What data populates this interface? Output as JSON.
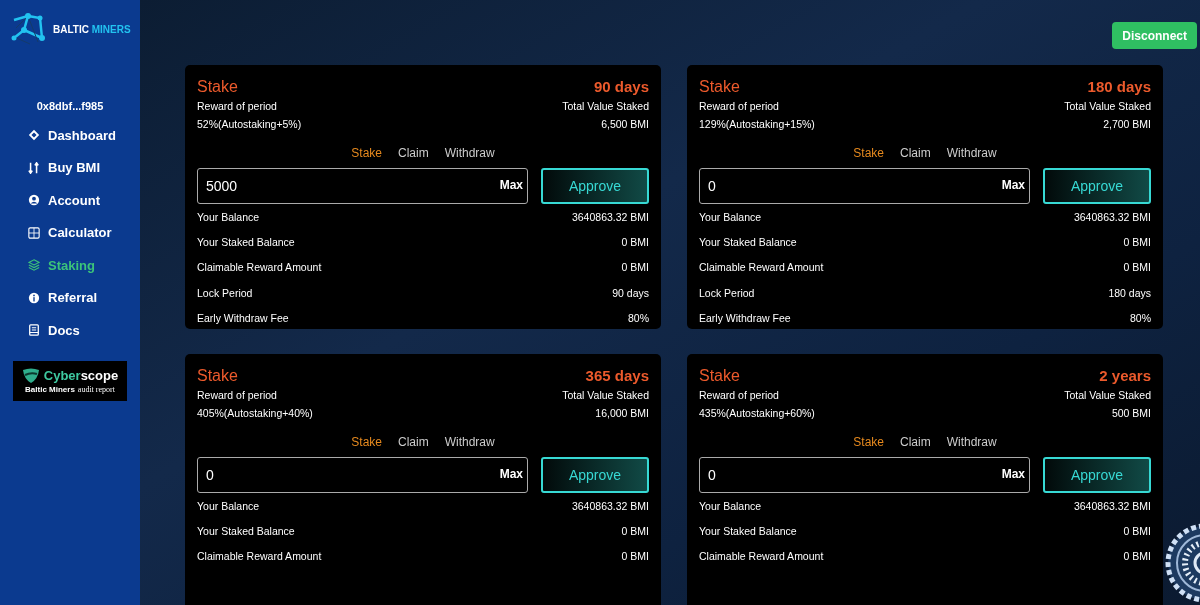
{
  "sidebar": {
    "logo": {
      "word_1": "BALTIC",
      "word_2": "MINERS"
    },
    "address": "0x8dbf...f985",
    "nav": [
      {
        "label": "Dashboard",
        "selected": false
      },
      {
        "label": "Buy BMI",
        "selected": false
      },
      {
        "label": "Account",
        "selected": false
      },
      {
        "label": "Calculator",
        "selected": false
      },
      {
        "label": "Staking",
        "selected": true
      },
      {
        "label": "Referral",
        "selected": false
      },
      {
        "label": "Docs",
        "selected": false
      }
    ],
    "audit_badge": {
      "brand_1": "Cyber",
      "brand_2": "scope",
      "project": "Baltic Miners",
      "caption": "audit report"
    }
  },
  "header": {
    "button": "Disconnect"
  },
  "pools": [
    {
      "title": "Stake",
      "period": "90 days",
      "reward_label": "Reward of period",
      "reward": "52%(Autostaking+5%)",
      "tvs_label": "Total Value Staked",
      "tvs": "6,500 BMI",
      "tabs": [
        {
          "label": "Stake",
          "selected": true
        },
        {
          "label": "Claim",
          "selected": false
        },
        {
          "label": "Withdraw",
          "selected": false
        }
      ],
      "amount": "5000",
      "max": "Max",
      "approve": "Approve",
      "stats": [
        {
          "label": "Your Balance",
          "value": "3640863.32 BMI"
        },
        {
          "label": "Your Staked Balance",
          "value": "0 BMI"
        },
        {
          "label": "Claimable Reward Amount",
          "value": "0 BMI"
        },
        {
          "label": "Lock Period",
          "value": "90 days"
        },
        {
          "label": "Early Withdraw Fee",
          "value": "80%"
        }
      ]
    },
    {
      "title": "Stake",
      "period": "180 days",
      "reward_label": "Reward of period",
      "reward": "129%(Autostaking+15%)",
      "tvs_label": "Total Value Staked",
      "tvs": "2,700 BMI",
      "tabs": [
        {
          "label": "Stake",
          "selected": true
        },
        {
          "label": "Claim",
          "selected": false
        },
        {
          "label": "Withdraw",
          "selected": false
        }
      ],
      "amount": "0",
      "max": "Max",
      "approve": "Approve",
      "stats": [
        {
          "label": "Your Balance",
          "value": "3640863.32 BMI"
        },
        {
          "label": "Your Staked Balance",
          "value": "0 BMI"
        },
        {
          "label": "Claimable Reward Amount",
          "value": "0 BMI"
        },
        {
          "label": "Lock Period",
          "value": "180 days"
        },
        {
          "label": "Early Withdraw Fee",
          "value": "80%"
        }
      ]
    },
    {
      "title": "Stake",
      "period": "365 days",
      "reward_label": "Reward of period",
      "reward": "405%(Autostaking+40%)",
      "tvs_label": "Total Value Staked",
      "tvs": "16,000 BMI",
      "tabs": [
        {
          "label": "Stake",
          "selected": true
        },
        {
          "label": "Claim",
          "selected": false
        },
        {
          "label": "Withdraw",
          "selected": false
        }
      ],
      "amount": "0",
      "max": "Max",
      "approve": "Approve",
      "stats": [
        {
          "label": "Your Balance",
          "value": "3640863.32 BMI"
        },
        {
          "label": "Your Staked Balance",
          "value": "0 BMI"
        },
        {
          "label": "Claimable Reward Amount",
          "value": "0 BMI"
        }
      ]
    },
    {
      "title": "Stake",
      "period": "2 years",
      "reward_label": "Reward of period",
      "reward": "435%(Autostaking+60%)",
      "tvs_label": "Total Value Staked",
      "tvs": "500 BMI",
      "tabs": [
        {
          "label": "Stake",
          "selected": true
        },
        {
          "label": "Claim",
          "selected": false
        },
        {
          "label": "Withdraw",
          "selected": false
        }
      ],
      "amount": "0",
      "max": "Max",
      "approve": "Approve",
      "stats": [
        {
          "label": "Your Balance",
          "value": "3640863.32 BMI"
        },
        {
          "label": "Your Staked Balance",
          "value": "0 BMI"
        },
        {
          "label": "Claimable Reward Amount",
          "value": "0 BMI"
        }
      ]
    }
  ]
}
